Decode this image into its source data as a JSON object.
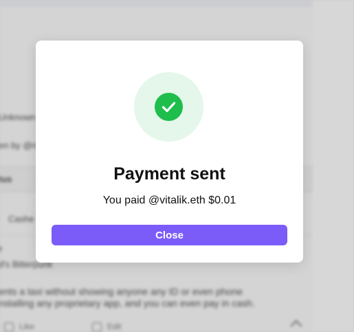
{
  "background": {
    "line1": "Unknown",
    "line2": "en by @ric",
    "row_label": "tus",
    "field_value": "Cashe",
    "line_short": "e",
    "line_hint": "d's Bitterpunk",
    "paragraph1": "ents a taxi without showing anyone any ID or even phone",
    "paragraph2": "nstalling any proprietary app, and you can even pay in cash.",
    "action1": "Like",
    "action2": "Edit"
  },
  "modal": {
    "icon": "check-circle-icon",
    "title": "Payment sent",
    "message": "You paid @vitalik.eth $0.01",
    "close_label": "Close"
  },
  "colors": {
    "accent": "#7b5cf9",
    "success": "#1fbd4c",
    "success_bg": "#e4f7ea"
  }
}
